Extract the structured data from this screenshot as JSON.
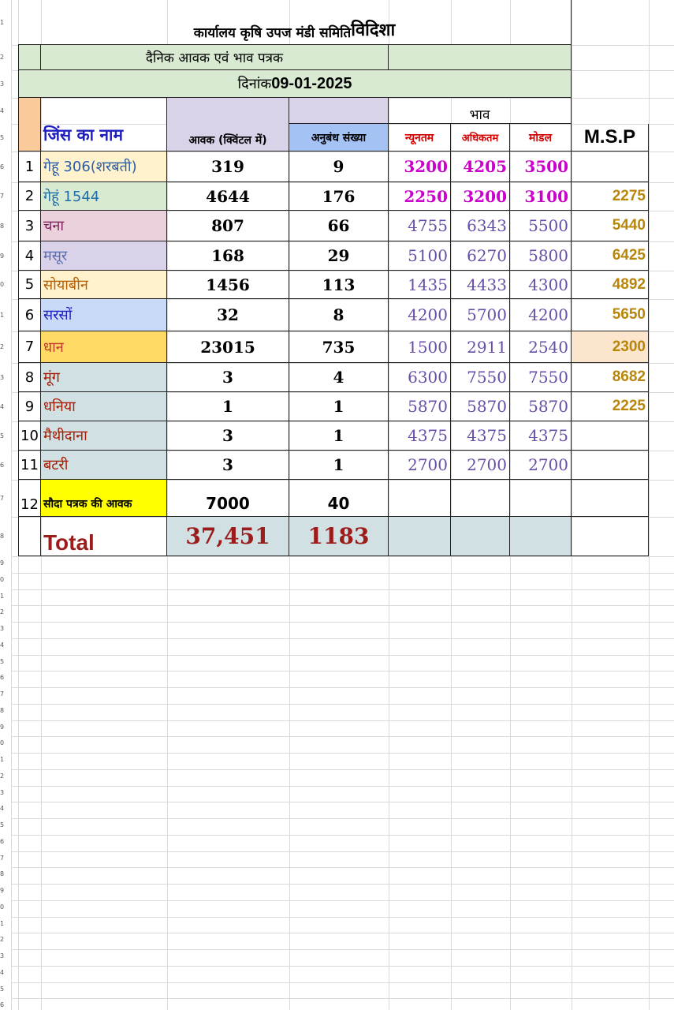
{
  "header": {
    "office_prefix": "कार्यालय कृषि उपज मंडी समिति",
    "office_city": "विदिशा",
    "subtitle": "दैनिक आवक एवं भाव पत्रक",
    "date_label": "दिनांक",
    "date_value": "09-01-2025"
  },
  "columns": {
    "commodity": "जिंस का नाम",
    "arrival": "आवक (क्विंटल में)",
    "contracts": "अनुबंध संख्या",
    "price_group": "भाव",
    "min": "न्यूनतम",
    "max": "अधिकतम",
    "modal": "मोडल",
    "msp": "M.S.P"
  },
  "rows": [
    {
      "no": "1",
      "name": "गेहू 306(शरबती)",
      "arrival": "319",
      "contracts": "9",
      "min": "3200",
      "max": "4205",
      "modal": "3500",
      "msp": ""
    },
    {
      "no": "2",
      "name": "गेहूं 1544",
      "arrival": "4644",
      "contracts": "176",
      "min": "2250",
      "max": "3200",
      "modal": "3100",
      "msp": "2275"
    },
    {
      "no": "3",
      "name": "चना",
      "arrival": "807",
      "contracts": "66",
      "min": "4755",
      "max": "6343",
      "modal": "5500",
      "msp": "5440"
    },
    {
      "no": "4",
      "name": "मसूर",
      "arrival": "168",
      "contracts": "29",
      "min": "5100",
      "max": "6270",
      "modal": "5800",
      "msp": "6425"
    },
    {
      "no": "5",
      "name": "सोयाबीन",
      "arrival": "1456",
      "contracts": "113",
      "min": "1435",
      "max": "4433",
      "modal": "4300",
      "msp": "4892"
    },
    {
      "no": "6",
      "name": "सरसों",
      "arrival": "32",
      "contracts": "8",
      "min": "4200",
      "max": "5700",
      "modal": "4200",
      "msp": "5650"
    },
    {
      "no": "7",
      "name": "धान",
      "arrival": "23015",
      "contracts": "735",
      "min": "1500",
      "max": "2911",
      "modal": "2540",
      "msp": "2300"
    },
    {
      "no": "8",
      "name": "मूंग",
      "arrival": "3",
      "contracts": "4",
      "min": "6300",
      "max": "7550",
      "modal": "7550",
      "msp": "8682"
    },
    {
      "no": "9",
      "name": "धनिया",
      "arrival": "1",
      "contracts": "1",
      "min": "5870",
      "max": "5870",
      "modal": "5870",
      "msp": "2225"
    },
    {
      "no": "10",
      "name": "मैथीदाना",
      "arrival": "3",
      "contracts": "1",
      "min": "4375",
      "max": "4375",
      "modal": "4375",
      "msp": ""
    },
    {
      "no": "11",
      "name": "बटरी",
      "arrival": "3",
      "contracts": "1",
      "min": "2700",
      "max": "2700",
      "modal": "2700",
      "msp": ""
    }
  ],
  "sauda": {
    "no": "12",
    "name": "सौदा पत्रक की आवक",
    "arrival": "7000",
    "contracts": "40"
  },
  "total": {
    "label": "Total",
    "arrival": "37,451",
    "contracts": "1183"
  },
  "row_numbers": [
    "1",
    "2",
    "3",
    "4",
    "5",
    "6",
    "7",
    "8",
    "9",
    "0",
    "1",
    "2",
    "3",
    "4",
    "5",
    "6",
    "7",
    "8",
    "9",
    "0",
    "1",
    "2",
    "3",
    "4",
    "5",
    "6",
    "7",
    "8",
    "9",
    "0",
    "1",
    "2",
    "3",
    "4",
    "5",
    "6",
    "7",
    "8",
    "9",
    "0",
    "1",
    "2",
    "3",
    "4",
    "5",
    "6"
  ],
  "colors": {
    "header_green": "#d9ead3",
    "header_lavender": "#d9d2e9",
    "header_blue": "#a4c2f4",
    "header_peach": "#f9cb9c",
    "commodity_title": "#1f1fbf",
    "price_header_red": "#d40000",
    "min_max_modal_top": "#cc00cc",
    "price_purple": "#674ea7",
    "msp_gold": "#b8860b",
    "total_red": "#9c1c1c",
    "sauda_yellow": "#ffff00",
    "total_fill": "#d0e0e3"
  }
}
